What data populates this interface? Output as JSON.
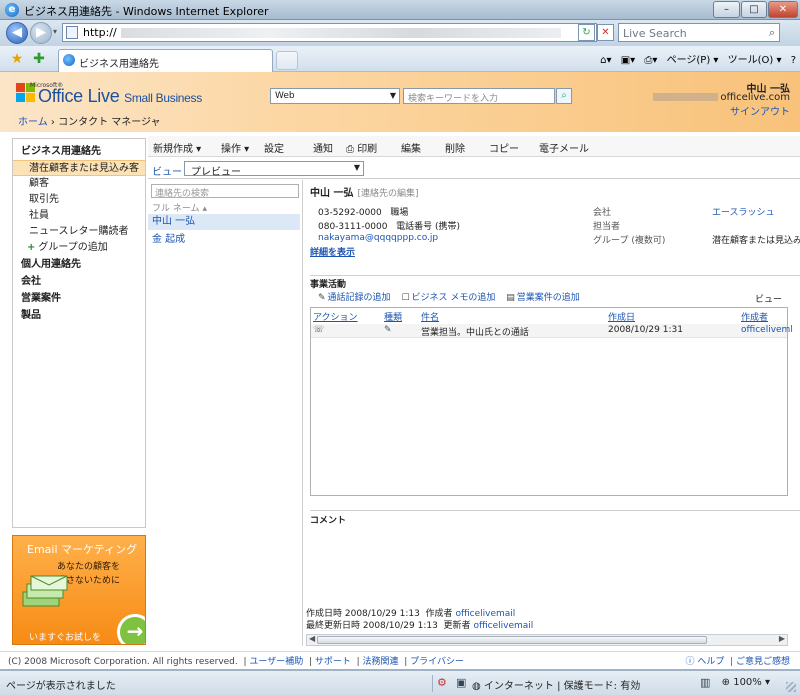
{
  "window": {
    "title": "ビジネス用連絡先 - Windows Internet Explorer",
    "minimize": "–",
    "maximize": "□",
    "close": "✕"
  },
  "address": {
    "url_prefix": "http://",
    "search_placeholder": "Live Search"
  },
  "tab": {
    "label": "ビジネス用連絡先"
  },
  "commands": {
    "page": "ページ(P) ▾",
    "tools": "ツール(O) ▾",
    "help": "?"
  },
  "header": {
    "logo_microsoft": "Microsoft®",
    "logo_office_live": "Office Live",
    "logo_small_business": "Small Business",
    "search_scope": "Web",
    "search_placeholder": "検索キーワードを入力",
    "user_name": "中山 一弘",
    "user_email_domain": "officelive.com",
    "signout": "サインアウト",
    "breadcrumb_home": "ホーム",
    "breadcrumb_sep": "›",
    "breadcrumb_current": "コンタクト マネージャ"
  },
  "sidebar": {
    "section_business": "ビジネス用連絡先",
    "items": [
      "潜在顧客または見込み客",
      "顧客",
      "取引先",
      "社員",
      "ニュースレター購読者"
    ],
    "add_group": "グループの追加",
    "section_personal": "個人用連絡先",
    "section_company": "会社",
    "section_deals": "営業案件",
    "section_products": "製品"
  },
  "ad": {
    "title": "Email マーケティング",
    "line1": "あなたの顧客を",
    "line2": "逃さないために",
    "cta": "いますぐお試しを"
  },
  "toolbar": {
    "new": "新規作成 ▾",
    "actions": "操作 ▾",
    "settings": "設定",
    "notify": "通知",
    "print": "印刷",
    "edit": "編集",
    "delete": "削除",
    "copy": "コピー",
    "email": "電子メール"
  },
  "view": {
    "label": "ビュー :",
    "selected": "プレビュー"
  },
  "list": {
    "search_placeholder": "連絡先の検索",
    "column_header": "フル ネーム",
    "rows": [
      "中山 一弘",
      "金 起成"
    ]
  },
  "detail": {
    "name": "中山 一弘",
    "edit_link": "[連絡先の編集]",
    "phone_work": "03-5292-0000",
    "phone_work_label": "職場",
    "phone_mobile": "080-3111-0000",
    "phone_mobile_label": "電話番号 (携帯)",
    "email": "nakayama@qqqqppp.co.jp",
    "company_label": "会社",
    "company_value": "エースラッシュ",
    "owner_label": "担当者",
    "group_label": "グループ (複数可)",
    "group_value": "潜在顧客または見込み",
    "more_link": "詳細を表示",
    "activities_title": "事業活動",
    "add_call": "通話記録の追加",
    "add_memo": "ビジネス メモの追加",
    "add_deal": "営業案件の追加",
    "view_label": "ビュー",
    "grid_headers": [
      "アクション",
      "種類",
      "件名",
      "作成日",
      "作成者"
    ],
    "grid_rows": [
      {
        "subject": "営業担当。中山氏との通話",
        "created": "2008/10/29 1:31",
        "author": "officeliveml"
      }
    ],
    "comment_title": "コメント",
    "created_label": "作成日時 2008/10/29 1:13",
    "created_by_label": "作成者",
    "created_by": "officelivemail",
    "modified_label": "最終更新日時 2008/10/29 1:13",
    "modified_by_label": "更新者",
    "modified_by": "officelivemail"
  },
  "footer": {
    "copyright": "(C) 2008 Microsoft Corporation. All rights reserved.",
    "links": [
      "ユーザー補助",
      "サポート",
      "法務関連",
      "プライバシー"
    ],
    "help": "ヘルプ",
    "feedback": "ご意見ご感想"
  },
  "status": {
    "text": "ページが表示されました",
    "zone": "インターネット | 保護モード: 有効",
    "zoom": "100%"
  }
}
